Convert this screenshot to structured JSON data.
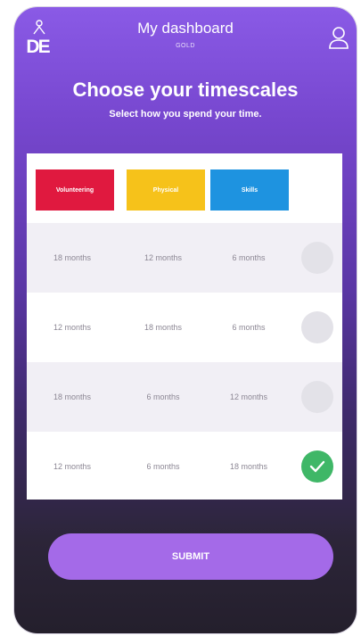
{
  "header": {
    "logo_text": "DE",
    "title": "My dashboard",
    "level": "GOLD"
  },
  "hero": {
    "title": "Choose your timescales",
    "subtitle": "Select how you spend your time."
  },
  "tabs": [
    {
      "label": "Volunteering",
      "color": "#e0193f"
    },
    {
      "label": "Physical",
      "color": "#f6c21a"
    },
    {
      "label": "Skills",
      "color": "#1e93e0"
    }
  ],
  "options": [
    {
      "volunteering": "18 months",
      "physical": "12 months",
      "skills": "6 months",
      "selected": false
    },
    {
      "volunteering": "12 months",
      "physical": "18 months",
      "skills": "6 months",
      "selected": false
    },
    {
      "volunteering": "18 months",
      "physical": "6 months",
      "skills": "12 months",
      "selected": false
    },
    {
      "volunteering": "12 months",
      "physical": "6 months",
      "skills": "18 months",
      "selected": true
    }
  ],
  "submit_label": "SUBMIT",
  "colors": {
    "accent": "#a46ae8",
    "check": "#3fb767"
  },
  "icons": {
    "logo": "dofe-person-logo",
    "user": "user-icon",
    "check": "check-icon"
  }
}
